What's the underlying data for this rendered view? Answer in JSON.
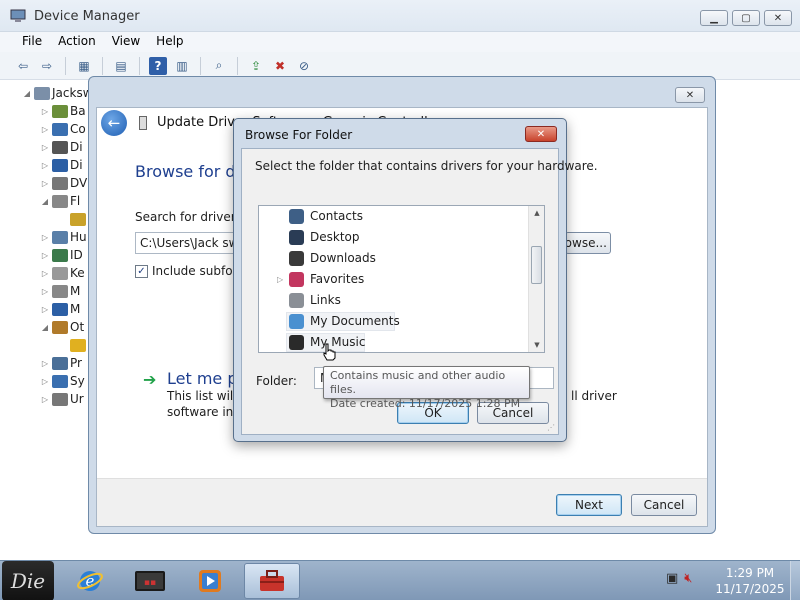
{
  "window": {
    "title": "Device Manager",
    "controls": {
      "minimize": "▁",
      "maximize": "▢",
      "close": "✕"
    }
  },
  "menubar": [
    "File",
    "Action",
    "View",
    "Help"
  ],
  "toolbar_icons": [
    "back-icon",
    "forward-icon",
    "properties-icon",
    "show-hidden-icon",
    "help-icon",
    "console-icon",
    "scan-hardware-icon",
    "update-driver-icon",
    "uninstall-icon",
    "disable-icon"
  ],
  "tree": [
    {
      "label": "Jacksw",
      "exp": "◢",
      "indent": 0,
      "color": "#7b8fa8"
    },
    {
      "label": "Ba",
      "exp": "▷",
      "indent": 1,
      "color": "#6b8f3a"
    },
    {
      "label": "Co",
      "exp": "▷",
      "indent": 1,
      "color": "#3a6fb0"
    },
    {
      "label": "Di",
      "exp": "▷",
      "indent": 1,
      "color": "#555555"
    },
    {
      "label": "Di",
      "exp": "▷",
      "indent": 1,
      "color": "#2c5fa5"
    },
    {
      "label": "DV",
      "exp": "▷",
      "indent": 1,
      "color": "#777777"
    },
    {
      "label": "Fl",
      "exp": "◢",
      "indent": 1,
      "color": "#888888"
    },
    {
      "label": "",
      "exp": "",
      "indent": 2,
      "color": "#c9a22a"
    },
    {
      "label": "Hu",
      "exp": "▷",
      "indent": 1,
      "color": "#5a7fa8"
    },
    {
      "label": "ID",
      "exp": "▷",
      "indent": 1,
      "color": "#3b7a4b"
    },
    {
      "label": "Ke",
      "exp": "▷",
      "indent": 1,
      "color": "#999999"
    },
    {
      "label": "M",
      "exp": "▷",
      "indent": 1,
      "color": "#888888"
    },
    {
      "label": "M",
      "exp": "▷",
      "indent": 1,
      "color": "#2c5fa5"
    },
    {
      "label": "Ot",
      "exp": "◢",
      "indent": 1,
      "color": "#b07a2a"
    },
    {
      "label": "",
      "exp": "",
      "indent": 2,
      "color": "#e0b020"
    },
    {
      "label": "Pr",
      "exp": "▷",
      "indent": 1,
      "color": "#4a6f98"
    },
    {
      "label": "Sy",
      "exp": "▷",
      "indent": 1,
      "color": "#3a6fb0"
    },
    {
      "label": "Ur",
      "exp": "▷",
      "indent": 1,
      "color": "#777777"
    }
  ],
  "update_driver": {
    "header": "Update Driver Software - Generic Controller",
    "heading": "Browse for dri",
    "search_label": "Search for driver so",
    "path_value": "C:\\Users\\Jack swe",
    "browse_label": "rowse...",
    "include_subfolders_label": "Include subfold",
    "include_subfolders_checked": "✓",
    "let_me_pick": "Let me pic",
    "desc_line1": "This list will s",
    "desc_line2": "software in t",
    "desc_right": "ll driver",
    "next_label": "Next",
    "cancel_label": "Cancel",
    "close_glyph": "✕"
  },
  "browse_folder": {
    "title": "Browse For Folder",
    "close_glyph": "✕",
    "prompt": "Select the folder that contains drivers for your hardware.",
    "folders": [
      {
        "label": "Contacts",
        "icon": "contacts-icon",
        "color": "#3e5f86",
        "exp": ""
      },
      {
        "label": "Desktop",
        "icon": "desktop-icon",
        "color": "#2a3c55",
        "exp": ""
      },
      {
        "label": "Downloads",
        "icon": "downloads-icon",
        "color": "#3a3a3a",
        "exp": ""
      },
      {
        "label": "Favorites",
        "icon": "favorites-icon",
        "color": "#c2365f",
        "exp": "▷"
      },
      {
        "label": "Links",
        "icon": "links-icon",
        "color": "#8a8f96",
        "exp": ""
      },
      {
        "label": "My Documents",
        "icon": "documents-icon",
        "color": "#4a90d0",
        "exp": ""
      },
      {
        "label": "My Music",
        "icon": "music-icon",
        "color": "#2a2a2a",
        "exp": ""
      }
    ],
    "folder_label": "Folder:",
    "folder_value": "M",
    "ok_label": "OK",
    "cancel_label": "Cancel"
  },
  "tooltip": {
    "line1": "Contains music and other audio files.",
    "line2": "Date created: 11/17/2025 1:28 PM"
  },
  "taskbar": {
    "start_text": "Die",
    "apps": [
      "internet-explorer-icon",
      "media-center-icon",
      "media-player-icon",
      "device-manager-toolbox-icon"
    ],
    "time": "1:29 PM",
    "date": "11/17/2025"
  }
}
